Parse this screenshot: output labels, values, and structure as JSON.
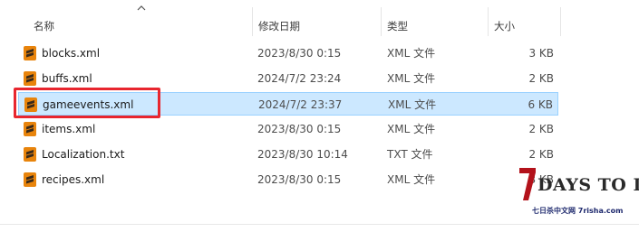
{
  "header": {
    "name": "名称",
    "modified": "修改日期",
    "type": "类型",
    "size": "大小"
  },
  "files": [
    {
      "name": "blocks.xml",
      "modified": "2023/8/30 0:15",
      "type": "XML 文件",
      "size": "3 KB",
      "selected": false
    },
    {
      "name": "buffs.xml",
      "modified": "2024/7/2 23:24",
      "type": "XML 文件",
      "size": "2 KB",
      "selected": false
    },
    {
      "name": "gameevents.xml",
      "modified": "2024/7/2 23:37",
      "type": "XML 文件",
      "size": "6 KB",
      "selected": true
    },
    {
      "name": "items.xml",
      "modified": "2023/8/30 0:15",
      "type": "XML 文件",
      "size": "2 KB",
      "selected": false
    },
    {
      "name": "Localization.txt",
      "modified": "2023/8/30 10:14",
      "type": "TXT 文件",
      "size": "2 KB",
      "selected": false
    },
    {
      "name": "recipes.xml",
      "modified": "2023/8/30 0:15",
      "type": "XML 文件",
      "size": "3 KB",
      "selected": false
    }
  ],
  "file_icon": "sublime-text-icon",
  "highlight_color": "#e8262f",
  "watermark": {
    "title": "DAYS TO DIE",
    "subtitle": "七日杀中文网 7risha.com"
  }
}
